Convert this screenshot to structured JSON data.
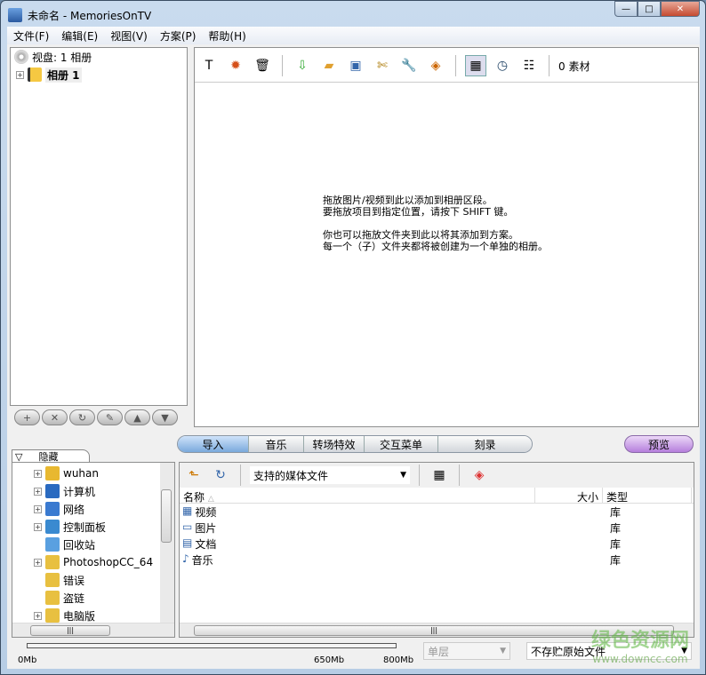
{
  "window": {
    "title": "未命名 - MemoriesOnTV",
    "min": "—",
    "max": "□",
    "close": "✕"
  },
  "menu": [
    "文件(F)",
    "编辑(E)",
    "视图(V)",
    "方案(P)",
    "帮助(H)"
  ],
  "tree": {
    "root": "视盘: 1 相册",
    "album": "相册 1"
  },
  "toolbar": {
    "count": "0 素材"
  },
  "dropzone": {
    "lines": [
      "拖放图片/视频到此以添加到相册区段。",
      "要拖放项目到指定位置，请按下 SHIFT 键。",
      "",
      "你也可以拖放文件夹到此以将其添加到方案。",
      "每一个（子）文件夹都将被创建为一个单独的相册。"
    ]
  },
  "album_buttons": [
    "+",
    "✕",
    "↻",
    "✎",
    "▲",
    "▼"
  ],
  "tabs": [
    "导入",
    "音乐",
    "转场特效",
    "交互菜单",
    "刻录"
  ],
  "preview": "预览",
  "hide_tab": "隐藏",
  "folders": [
    "wuhan",
    "计算机",
    "网络",
    "控制面板",
    "回收站",
    "PhotoshopCC_64",
    "错误",
    "盗链",
    "电脑版"
  ],
  "explorer": {
    "filter": "支持的媒体文件",
    "columns": {
      "name": "名称",
      "size": "大小",
      "type": "类型"
    },
    "rows": [
      {
        "name": "视频",
        "type": "库"
      },
      {
        "name": "图片",
        "type": "库"
      },
      {
        "name": "文档",
        "type": "库"
      },
      {
        "name": "音乐",
        "type": "库"
      }
    ]
  },
  "status": {
    "ticks": [
      "0Mb",
      "650Mb",
      "800Mb"
    ],
    "layer": "单层",
    "storage": "不存贮原始文件",
    "progress": 0
  },
  "watermark": {
    "name": "绿色资源网",
    "url": "www.downcc.com"
  }
}
